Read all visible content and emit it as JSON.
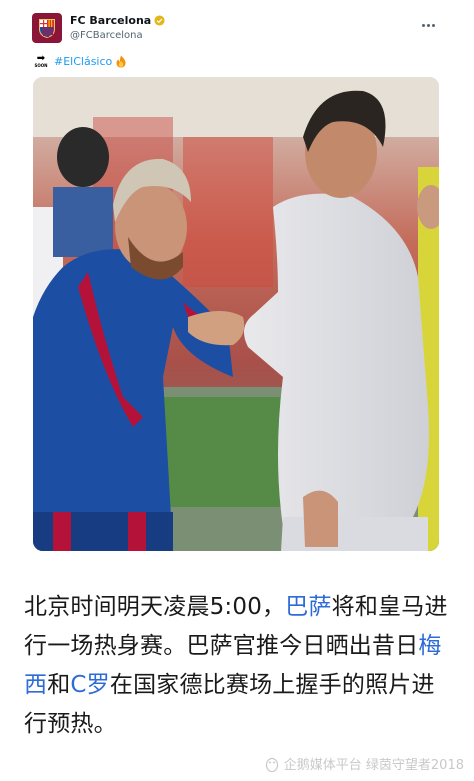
{
  "account": {
    "display_name": "FC Barcelona",
    "handle": "@FCBarcelona",
    "avatar_icon": "fc-barcelona-crest",
    "verified_icon": "gold-verified-badge"
  },
  "tweet": {
    "soon_icon_label": "SOON",
    "hashtag": "#ElClásico",
    "emoji_icon": "fire-emoji"
  },
  "media": {
    "description_icon": "photo"
  },
  "caption": {
    "part1": "北京时间明天凌晨5:00，",
    "link1": "巴萨",
    "part2": "将和皇马进行一场热身赛。巴萨官推今日晒出昔日",
    "link2": "梅西",
    "part3": "和",
    "link3": "C罗",
    "part4": "在国家德比赛场上握手的照片进行预热。"
  },
  "watermark": {
    "text": "企鹅媒体平台 绿茵守望者2018"
  },
  "colors": {
    "link": "#2e6bd6",
    "hashtag": "#1d9bf0",
    "barca_blue": "#1c4fa3",
    "barca_red": "#b5123a"
  }
}
